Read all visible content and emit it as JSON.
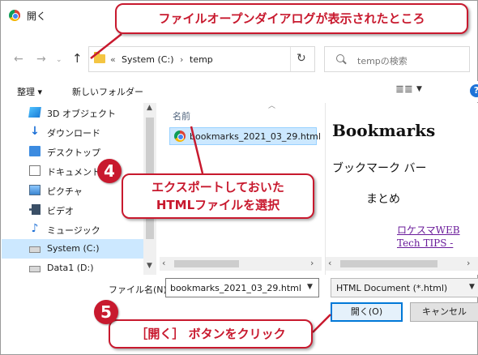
{
  "window": {
    "title": "開く"
  },
  "address": {
    "sep": "«",
    "drive": "System (C:)",
    "arrow": "›",
    "folder": "temp"
  },
  "search": {
    "placeholder": "tempの検索"
  },
  "toolbar": {
    "organize": "整理 ▾",
    "new_folder": "新しいフォルダー",
    "view_icon": "≣≣",
    "help": "?"
  },
  "nav": {
    "items": [
      {
        "label": "3D オブジェクト",
        "icon": "3d-objects-icon"
      },
      {
        "label": "ダウンロード",
        "icon": "download-icon"
      },
      {
        "label": "デスクトップ",
        "icon": "desktop-icon"
      },
      {
        "label": "ドキュメント",
        "icon": "document-icon"
      },
      {
        "label": "ピクチャ",
        "icon": "pictures-icon"
      },
      {
        "label": "ビデオ",
        "icon": "video-icon"
      },
      {
        "label": "ミュージック",
        "icon": "music-icon"
      },
      {
        "label": "System (C:)",
        "icon": "drive-icon",
        "selected": true
      },
      {
        "label": "Data1 (D:)",
        "icon": "drive-icon"
      }
    ]
  },
  "files": {
    "column_name": "名前",
    "items": [
      {
        "name": "bookmarks_2021_03_29.html",
        "selected": true
      }
    ]
  },
  "preview": {
    "heading": "Bookmarks",
    "bar": "ブックマーク バー",
    "summary": "まとめ",
    "link1": "ロケスマWEB",
    "link2": "Tech TIPS -"
  },
  "bottom": {
    "filename_label": "ファイル名(N):",
    "filename_value": "bookmarks_2021_03_29.html",
    "filetype": "HTML Document (*.html)",
    "open_button": "開く(O)",
    "cancel_button": "キャンセル"
  },
  "callouts": {
    "top": "ファイルオープンダイアログが表示されたところ",
    "mid_line1": "エクスポートしておいた",
    "mid_line2": "HTMLファイルを選択",
    "bottom": "［開く］ ボタンをクリック",
    "badge4": "4",
    "badge5": "5"
  },
  "colors": {
    "accent_red": "#c8192e",
    "selection": "#cce8ff",
    "primary_button_border": "#0078d7"
  }
}
